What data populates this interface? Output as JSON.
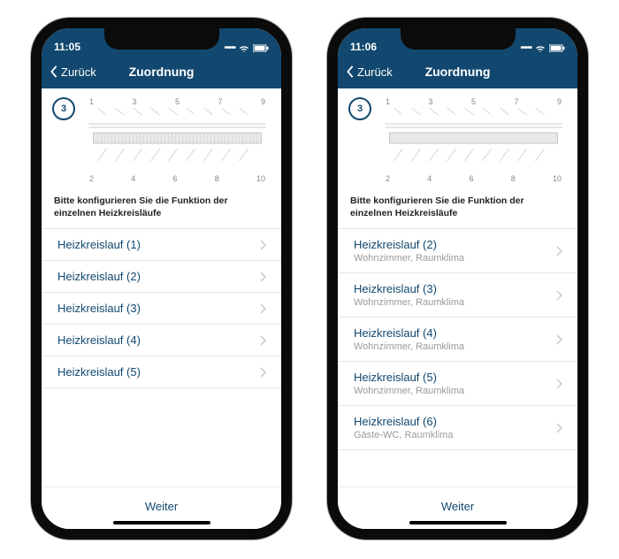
{
  "phones": [
    {
      "status_time": "11:05",
      "back_label": "Zurück",
      "nav_title": "Zuordnung",
      "step_number": "3",
      "top_numbers": [
        "1",
        "3",
        "5",
        "7",
        "9"
      ],
      "bottom_numbers": [
        "2",
        "4",
        "6",
        "8",
        "10"
      ],
      "instruction": "Bitte konfigurieren Sie die Funktion der einzelnen Heizkreisläufe",
      "items": [
        {
          "title": "Heizkreislauf (1)",
          "sub": ""
        },
        {
          "title": "Heizkreislauf (2)",
          "sub": ""
        },
        {
          "title": "Heizkreislauf (3)",
          "sub": ""
        },
        {
          "title": "Heizkreislauf (4)",
          "sub": ""
        },
        {
          "title": "Heizkreislauf (5)",
          "sub": ""
        }
      ],
      "footer_label": "Weiter"
    },
    {
      "status_time": "11:06",
      "back_label": "Zurück",
      "nav_title": "Zuordnung",
      "step_number": "3",
      "top_numbers": [
        "1",
        "3",
        "5",
        "7",
        "9"
      ],
      "bottom_numbers": [
        "2",
        "4",
        "6",
        "8",
        "10"
      ],
      "instruction": "Bitte konfigurieren Sie die Funktion der einzelnen Heizkreisläufe",
      "items": [
        {
          "title": "Heizkreislauf (2)",
          "sub": "Wohnzimmer, Raumklima"
        },
        {
          "title": "Heizkreislauf (3)",
          "sub": "Wohnzimmer, Raumklima"
        },
        {
          "title": "Heizkreislauf (4)",
          "sub": "Wohnzimmer, Raumklima"
        },
        {
          "title": "Heizkreislauf (5)",
          "sub": "Wohnzimmer, Raumklima"
        },
        {
          "title": "Heizkreislauf (6)",
          "sub": "Gäste-WC, Raumklima"
        }
      ],
      "footer_label": "Weiter"
    }
  ],
  "colors": {
    "brand": "#12486f"
  }
}
